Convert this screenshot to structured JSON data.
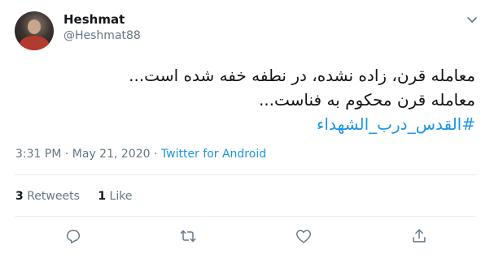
{
  "user": {
    "name": "Heshmat",
    "handle": "@Heshmat88"
  },
  "tweet": {
    "line1": "معامله قرن، زاده نشده، در نطفه خفه شده است...",
    "line2": "معامله قرن محکوم به فناست...",
    "hashtag": "#القدس_درب_الشهداء"
  },
  "meta": {
    "time": "3:31 PM",
    "separator1": "·",
    "date": "May 21, 2020",
    "separator2": "·",
    "source": "Twitter for Android"
  },
  "stats": {
    "retweets_count": "3",
    "retweets_label": "Retweets",
    "likes_count": "1",
    "likes_label": "Like"
  },
  "icons": {
    "more": "chevron-down-icon",
    "reply": "reply-icon",
    "retweet": "retweet-icon",
    "like": "heart-icon",
    "share": "share-icon"
  },
  "colors": {
    "accent": "#1b95e0",
    "secondary_text": "#657786",
    "primary_text": "#14171a",
    "divider": "#e6ecf0"
  }
}
